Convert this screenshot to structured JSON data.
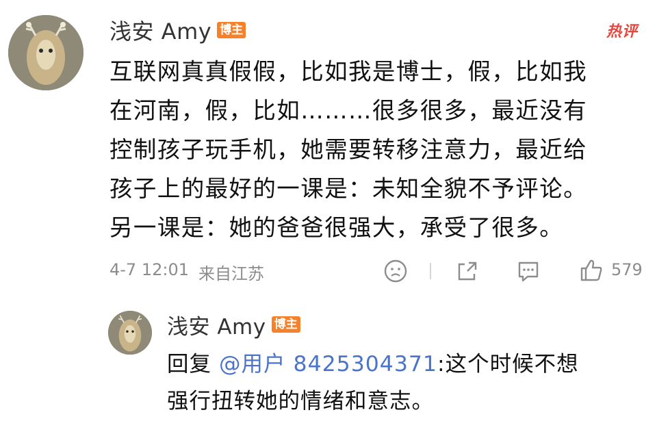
{
  "comment": {
    "username": "浅安 Amy",
    "badge": "博主",
    "hot_label": "热评",
    "text_lines": [
      "互联网真真假假，比如我是博士，假，比如我",
      "在河南，假，比如………很多很多，最近没有",
      "控制孩子玩手机，她需要转移注意力，最近给",
      "孩子上的最好的一课是：未知全貌不予评论。",
      "另一课是：她的爸爸很强大，承受了很多。"
    ],
    "timestamp": "4-7 12:01",
    "location": "来自江苏",
    "like_count": "579"
  },
  "reply": {
    "username": "浅安 Amy",
    "badge": "博主",
    "prefix": "回复 ",
    "mention": "@用户 8425304371",
    "text_line1_rest": ":这个时候不想",
    "text_line2": "强行扭转她的情绪和意志。"
  },
  "icons": {
    "emoji": "emoji-face-icon",
    "share": "share-icon",
    "comment": "comment-icon",
    "like": "thumbs-up-icon"
  }
}
